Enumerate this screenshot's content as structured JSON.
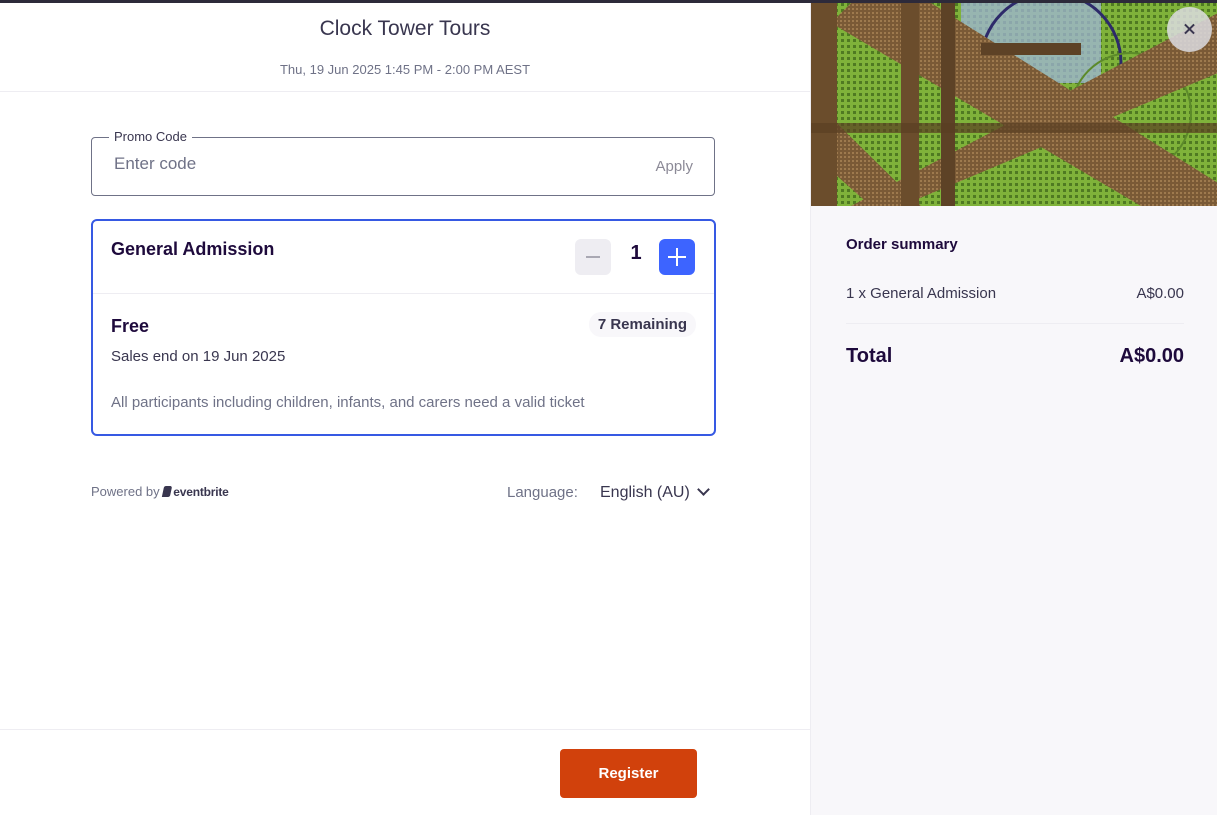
{
  "event": {
    "title": "Clock Tower Tours",
    "datetime": "Thu, 19 Jun 2025 1:45 PM - 2:00 PM AEST"
  },
  "promo": {
    "label": "Promo Code",
    "placeholder": "Enter code",
    "value": "",
    "apply_label": "Apply"
  },
  "ticket": {
    "name": "General Admission",
    "quantity": "1",
    "price": "Free",
    "remaining": "7 Remaining",
    "sales_end": "Sales end on 19 Jun 2025",
    "description": "All participants including children, infants, and carers need a valid ticket"
  },
  "footer_meta": {
    "powered_by": "Powered by",
    "brand": "eventbrite",
    "language_label": "Language:",
    "language_value": "English (AU)"
  },
  "actions": {
    "register_label": "Register"
  },
  "summary": {
    "title": "Order summary",
    "line_item": "1 x General Admission",
    "line_price": "A$0.00",
    "total_label": "Total",
    "total_value": "A$0.00"
  },
  "icons": {
    "close": "close-icon",
    "minus": "minus-icon",
    "plus": "plus-icon",
    "chevron": "chevron-down-icon",
    "brand": "eventbrite-logo-icon"
  },
  "colors": {
    "accent_blue": "#3d64ff",
    "ticket_border": "#3659e3",
    "register_orange": "#d1410c",
    "text_dark": "#1e0a3c",
    "text_muted": "#6f7287"
  }
}
